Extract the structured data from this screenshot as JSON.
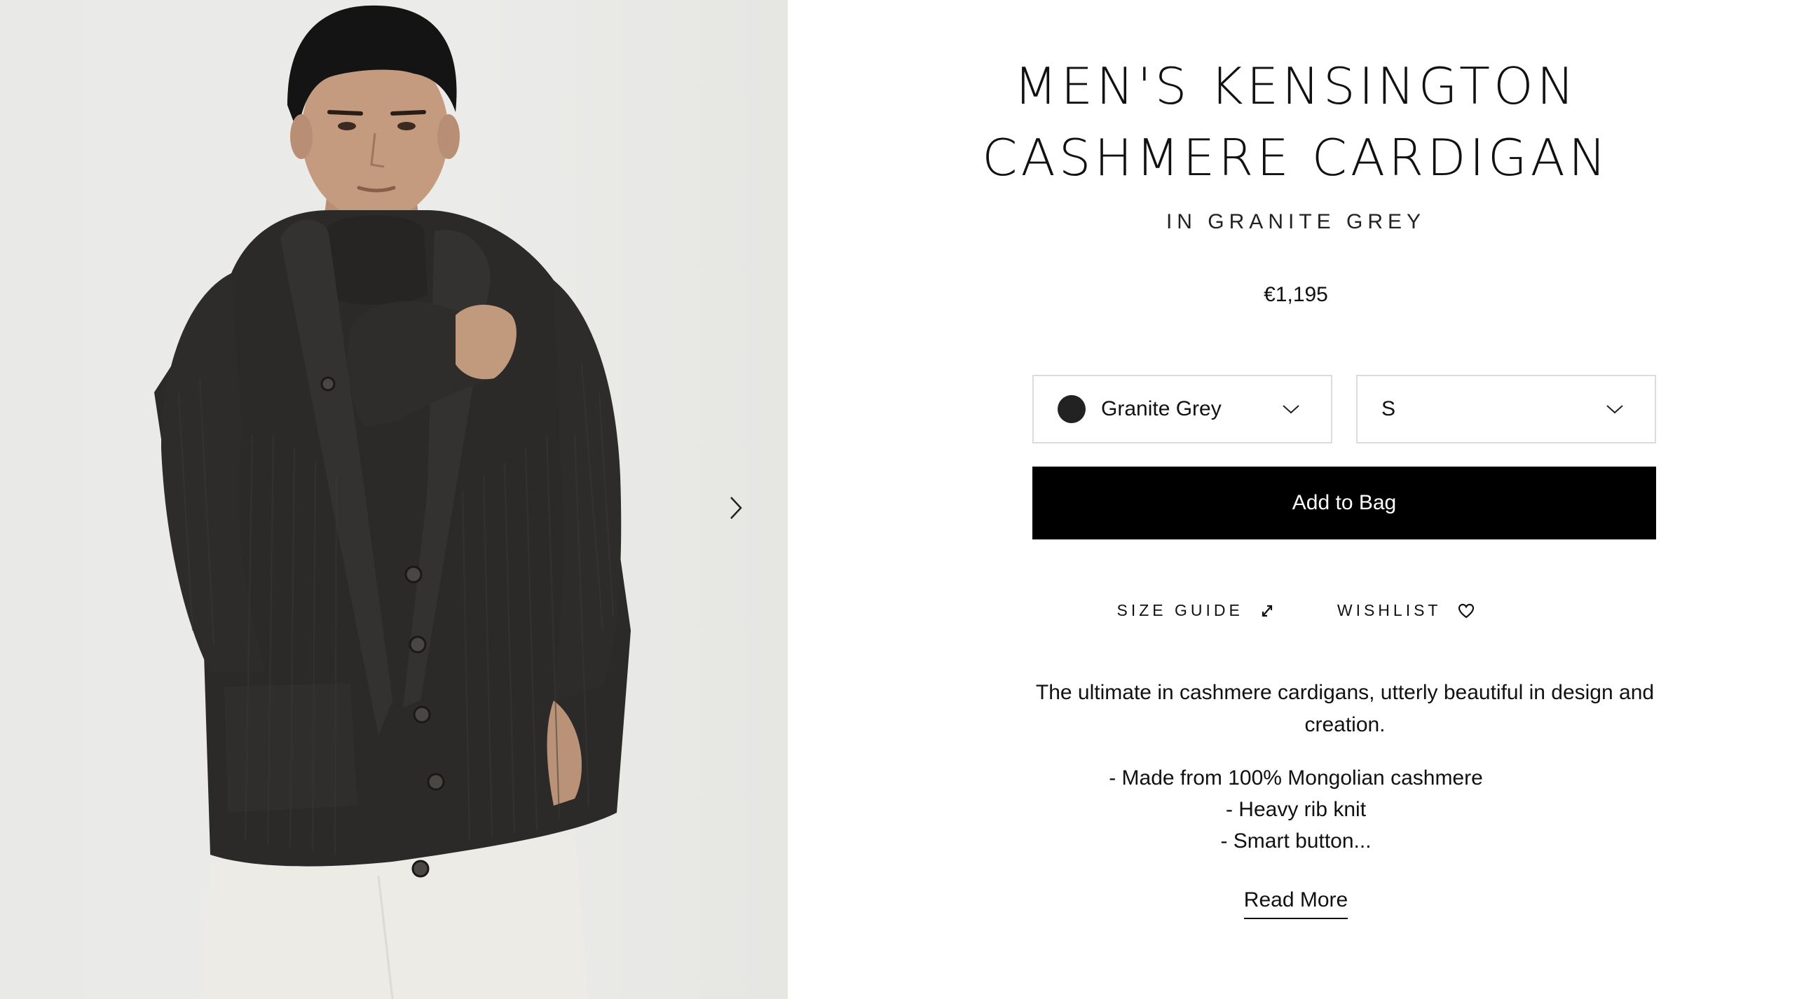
{
  "product": {
    "title_line1": "MEN'S KENSINGTON",
    "title_line2": "CASHMERE CARDIGAN",
    "subtitle": "IN GRANITE GREY",
    "price": "€1,195",
    "colour_select": {
      "value": "Granite Grey",
      "swatch_color": "#222222"
    },
    "size_select": {
      "value": "S"
    },
    "add_to_bag_label": "Add to Bag",
    "size_guide_label": "SIZE GUIDE",
    "wishlist_label": "WISHLIST",
    "description": "The ultimate in cashmere cardigans, utterly beautiful in design and creation.",
    "features": [
      "- Made from 100% Mongolian cashmere",
      "- Heavy rib knit",
      "- Smart button..."
    ],
    "read_more_label": "Read More"
  },
  "gallery": {
    "next_icon": "chevron-right-icon"
  },
  "colors": {
    "button_bg": "#000000",
    "button_text": "#ffffff",
    "border": "#dcdcdc"
  }
}
